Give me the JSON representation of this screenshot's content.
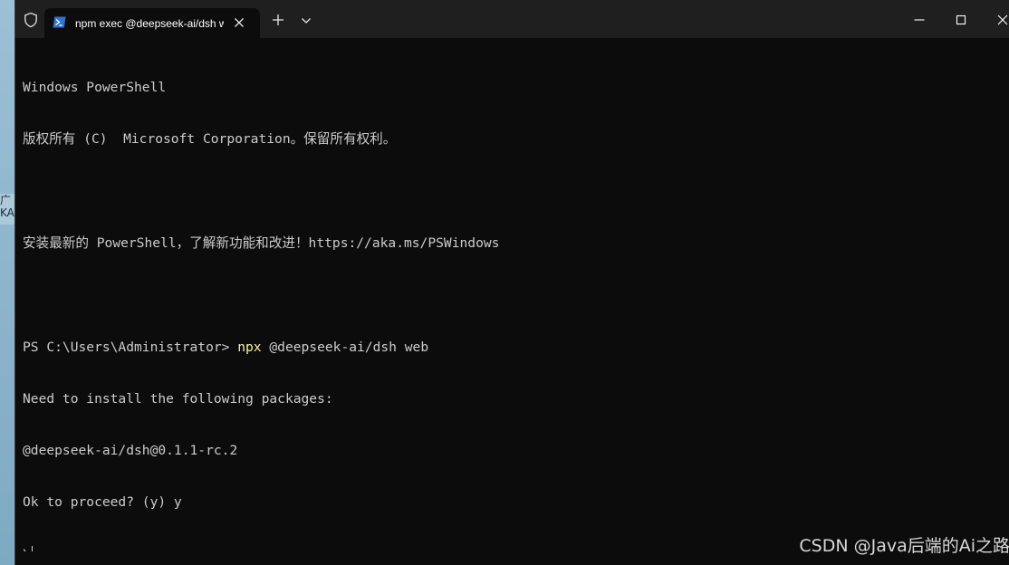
{
  "desktop": {
    "fragment_text_1": "广",
    "fragment_text_2": "KA"
  },
  "titlebar": {
    "tab_title": "npm exec @deepseek-ai/dsh web",
    "icons": {
      "shield": "shield-icon",
      "tab": "powershell-icon",
      "tab_close": "close-icon",
      "new_tab": "plus-icon",
      "dropdown": "chevron-down-icon",
      "minimize": "minimize-icon",
      "maximize": "maximize-icon",
      "close": "close-icon"
    }
  },
  "terminal": {
    "line1": "Windows PowerShell",
    "line2": "版权所有 (C)  Microsoft Corporation。保留所有权利。",
    "line3": "",
    "line4": "安装最新的 PowerShell，了解新功能和改进！https://aka.ms/PSWindows",
    "line5": "",
    "prompt": "PS C:\\Users\\Administrator> ",
    "command_name": "npx",
    "command_args": " @deepseek-ai/dsh web",
    "line7": "Need to install the following packages:",
    "line8": "@deepseek-ai/dsh@0.1.1-rc.2",
    "line9": "Ok to proceed? (y) y",
    "line10": "\\"
  },
  "watermark": {
    "text": "CSDN @Java后端的Ai之路"
  },
  "colors": {
    "background": "#0c0c0c",
    "titlebar": "#1f1f1f",
    "text": "#cccccc",
    "command": "#f9f1a5"
  }
}
